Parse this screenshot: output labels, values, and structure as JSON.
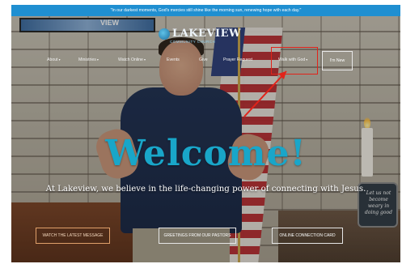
{
  "announcement": "\"In our darkest moments, God's mercies still shine like the morning sun, renewing hope with each day.\"",
  "logo": {
    "name": "LAKEVIEW",
    "subtitle": "COMMUNITY CHURCH"
  },
  "screen_text": "VIEW",
  "nav": {
    "items": [
      {
        "label": "About",
        "has_dropdown": true
      },
      {
        "label": "Ministries",
        "has_dropdown": true
      },
      {
        "label": "Watch Online",
        "has_dropdown": true
      },
      {
        "label": "Events",
        "has_dropdown": false
      },
      {
        "label": "Give",
        "has_dropdown": false
      },
      {
        "label": "Prayer Request",
        "has_dropdown": false
      },
      {
        "label": "Walk with God",
        "has_dropdown": true
      }
    ],
    "caret": "▾",
    "im_new": "I'm New"
  },
  "hero": {
    "heading": "Welcome!",
    "tagline": "At Lakeview, we believe in the life-changing power of connecting with Jesus."
  },
  "cta": {
    "latest_message": "WATCH THE LATEST MESSAGE",
    "pastors": "GREETINGS FROM OUR PASTORS",
    "connection_card": "ONLINE CONNECTION CARD"
  },
  "sign_text": "Let us not become weary in doing good",
  "colors": {
    "announcement_bar": "#1f8fd1",
    "welcome_text": "#19a6c9",
    "highlight_box": "#e2231a",
    "annotation_arrow": "#e2231a"
  },
  "icons": {
    "logo": "globe-swirl-icon",
    "annotation": "red-arrow-icon"
  }
}
